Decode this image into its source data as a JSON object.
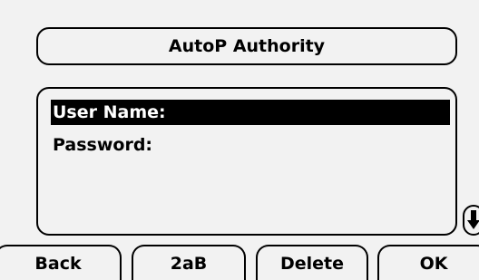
{
  "screen": {
    "title": "AutoP Authority",
    "fields": [
      {
        "label": "User Name:",
        "selected": true
      },
      {
        "label": "Password:",
        "selected": false
      }
    ],
    "scroll_icon": "scroll-down-icon"
  },
  "softkeys": [
    {
      "label": "Back"
    },
    {
      "label": "2aB"
    },
    {
      "label": "Delete"
    },
    {
      "label": "OK"
    }
  ],
  "colors": {
    "background": "#f2f2f2",
    "foreground": "#000000",
    "selection_text": "#ffffff"
  }
}
